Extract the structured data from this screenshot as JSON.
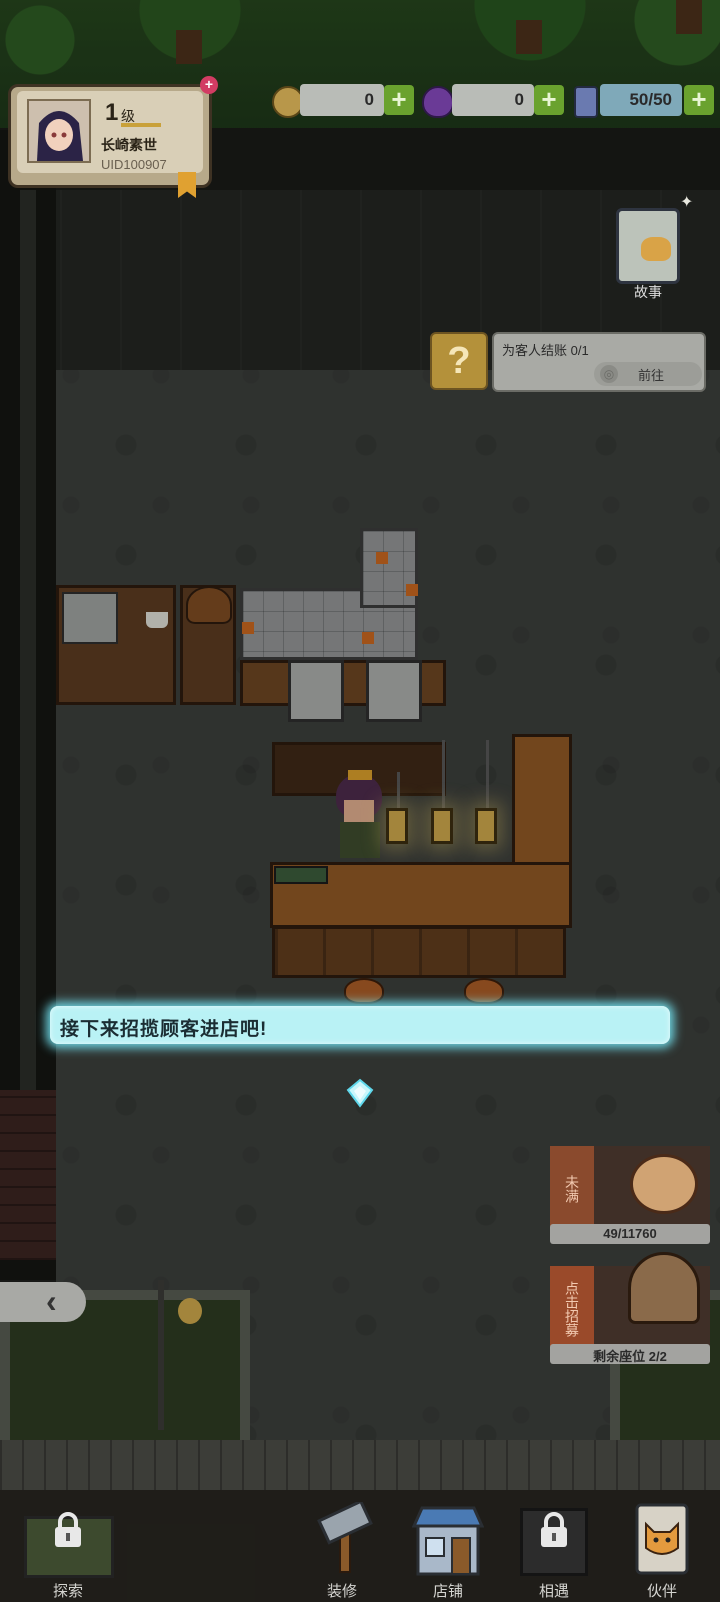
{
  "player": {
    "level_number": "1",
    "level_unit": "级",
    "name": "长崎素世",
    "uid": "UID100907",
    "notification_mark": "+"
  },
  "resources": [
    {
      "icon": "coin-icon",
      "value": "0",
      "plus": "+"
    },
    {
      "icon": "purple-gem-icon",
      "value": "0",
      "plus": "+"
    },
    {
      "icon": "potion-bottle-icon",
      "value": "50/50",
      "plus": "+"
    }
  ],
  "story": {
    "label": "故事"
  },
  "quest": {
    "icon_text": "?",
    "text": "为客人结账 0/1",
    "go_label": "前往"
  },
  "tutorial": {
    "message": "接下来招揽顾客进店吧!"
  },
  "side_cards": {
    "piggy": {
      "tag": "未满",
      "progress": "49/11760"
    },
    "bell": {
      "tag": "点击招募",
      "seats": "剩余座位 2/2"
    }
  },
  "collapse_arrow": "‹",
  "nav": [
    {
      "id": "explore",
      "label": "探索",
      "locked": true
    },
    {
      "id": "decorate",
      "label": "装修",
      "locked": false
    },
    {
      "id": "shop",
      "label": "店铺",
      "locked": false
    },
    {
      "id": "encounter",
      "label": "相遇",
      "locked": true
    },
    {
      "id": "partner",
      "label": "伙伴",
      "locked": false
    }
  ],
  "colors": {
    "tutorial_glow": "#78f0ff",
    "plus_button": "#6aa22e",
    "notification": "#d23c63"
  }
}
